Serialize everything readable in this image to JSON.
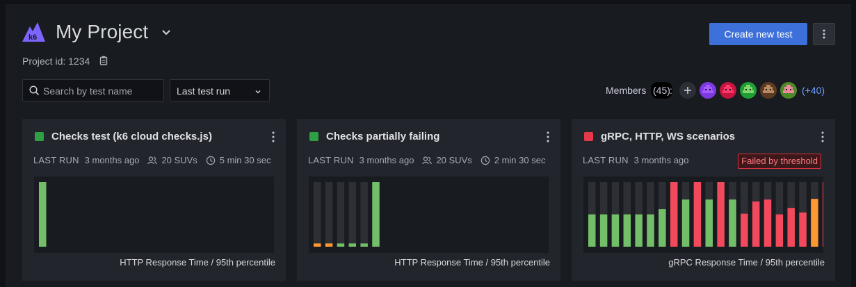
{
  "header": {
    "title": "My Project",
    "project_id": "Project id: 1234",
    "create_button": "Create new test"
  },
  "filters": {
    "search_placeholder": "Search by test name",
    "sort_value": "Last test run"
  },
  "members": {
    "label": "Members",
    "count": "(45)",
    "colon": ":",
    "more": "(+40)",
    "avatars": [
      {
        "bg": "#7c3ae0",
        "fg": "#a55cff"
      },
      {
        "bg": "#c4163f",
        "fg": "#ff3a6a"
      },
      {
        "bg": "#1e9e35",
        "fg": "#7fd86b"
      },
      {
        "bg": "#5b3a24",
        "fg": "#b98b5f"
      },
      {
        "bg": "#4f8a2a",
        "fg": "#f08aa0"
      }
    ]
  },
  "colors": {
    "status_green": "#2ea043",
    "status_red": "#e5394a",
    "bar_green": "#73bf69",
    "bar_red": "#f2495c",
    "bar_orange": "#ff9830",
    "bar_track": "#2d2f34"
  },
  "cards": [
    {
      "title": "Checks test (k6 cloud checks.js)",
      "status": "green",
      "last_run_label": "LAST RUN",
      "last_run": "3 months ago",
      "vus": "20 SUVs",
      "duration": "5 min 30 sec",
      "chart_label": "HTTP Response Time / 95th percentile"
    },
    {
      "title": "Checks partially failing",
      "status": "green",
      "last_run_label": "LAST RUN",
      "last_run": "3 months ago",
      "vus": "20 SUVs",
      "duration": "2 min 30 sec",
      "chart_label": "HTTP Response Time / 95th percentile"
    },
    {
      "title": "gRPC, HTTP, WS scenarios",
      "status": "red",
      "last_run_label": "LAST RUN",
      "last_run": "3 months ago",
      "badge": "Failed by threshold",
      "chart_label": "gRPC Response Time / 95th percentile"
    }
  ],
  "chart_data": [
    {
      "type": "bar",
      "title": "HTTP Response Time / 95th percentile",
      "values": [
        1.0
      ],
      "colors": [
        "green"
      ]
    },
    {
      "type": "bar",
      "title": "HTTP Response Time / 95th percentile",
      "values": [
        0.05,
        0.05,
        0.05,
        0.05,
        0.05,
        1.0
      ],
      "colors": [
        "orange",
        "orange",
        "green",
        "green",
        "green",
        "green"
      ]
    },
    {
      "type": "bar",
      "title": "gRPC Response Time / 95th percentile",
      "values": [
        0.5,
        0.5,
        0.5,
        0.5,
        0.5,
        0.5,
        0.58,
        1.0,
        0.73,
        1.0,
        0.73,
        1.0,
        0.73,
        0.51,
        0.7,
        0.73,
        0.5,
        0.6,
        0.53,
        0.74,
        1.0
      ],
      "colors": [
        "green",
        "green",
        "green",
        "green",
        "green",
        "green",
        "green",
        "red",
        "green",
        "red",
        "green",
        "red",
        "green",
        "red",
        "red",
        "red",
        "red",
        "red",
        "red",
        "orange",
        "red"
      ]
    }
  ]
}
